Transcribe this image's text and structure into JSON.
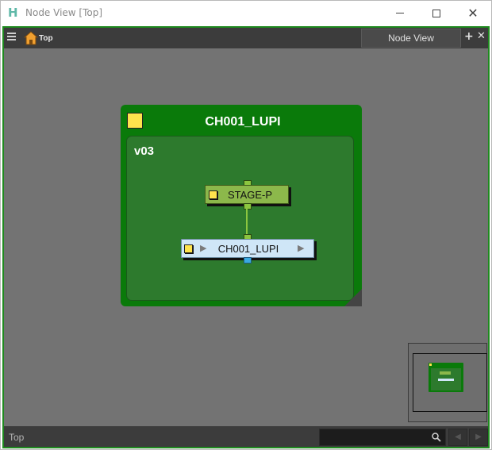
{
  "window": {
    "app_icon": "H",
    "title": "Node View [Top]",
    "minimize_icon": "minimize-icon",
    "maximize_icon": "maximize-icon",
    "close_icon": "close-icon"
  },
  "toolbar": {
    "menu_icon": "menu-icon",
    "home_icon": "home-icon",
    "breadcrumb": "Top",
    "tab_label": "Node View",
    "add_tab": "+",
    "close_tab": "✕"
  },
  "graph": {
    "group": {
      "title": "CH001_LUPI",
      "version": "v03",
      "color": "#0a7a0a",
      "swatch_color": "#ffe34d"
    },
    "nodes": [
      {
        "label": "STAGE-P",
        "color": "#8cb84b"
      },
      {
        "label": "CH001_LUPI",
        "color": "#cfe6f7",
        "arrow_left": "▶",
        "arrow_right": "▶"
      }
    ]
  },
  "statusbar": {
    "path": "Top",
    "search_value": "",
    "search_icon": "search-icon",
    "prev": "◀",
    "next": "▶"
  },
  "colors": {
    "frame_accent": "#1f8a1f",
    "canvas": "#737373"
  }
}
